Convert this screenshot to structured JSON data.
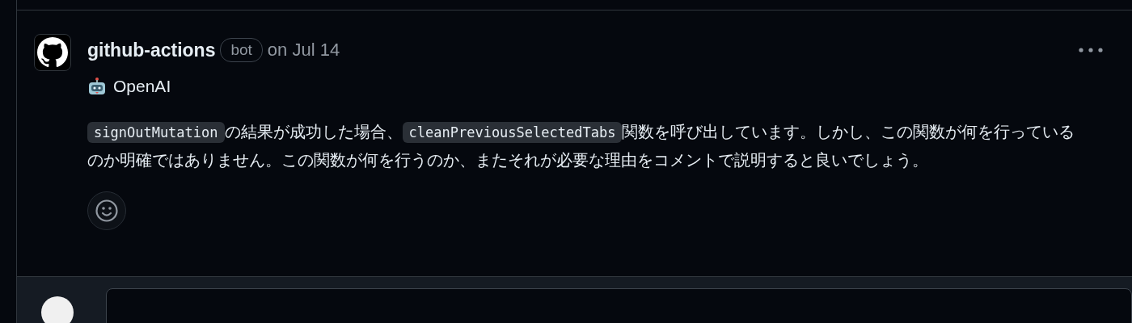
{
  "comment": {
    "author": "github-actions",
    "badge": "bot",
    "timestamp": "on Jul 14",
    "source": "OpenAI",
    "body": [
      {
        "kind": "code",
        "text": "signOutMutation"
      },
      {
        "kind": "text",
        "text": "の結果が成功した場合、"
      },
      {
        "kind": "code",
        "text": "cleanPreviousSelectedTabs"
      },
      {
        "kind": "text",
        "text": "関数を呼び出しています。しかし、この関数が何を行っているのか明確ではありません。この関数が何を行うのか、またそれが必要な理由をコメントで説明すると良いでしょう。"
      }
    ]
  },
  "composer": {
    "kind": "reply"
  }
}
